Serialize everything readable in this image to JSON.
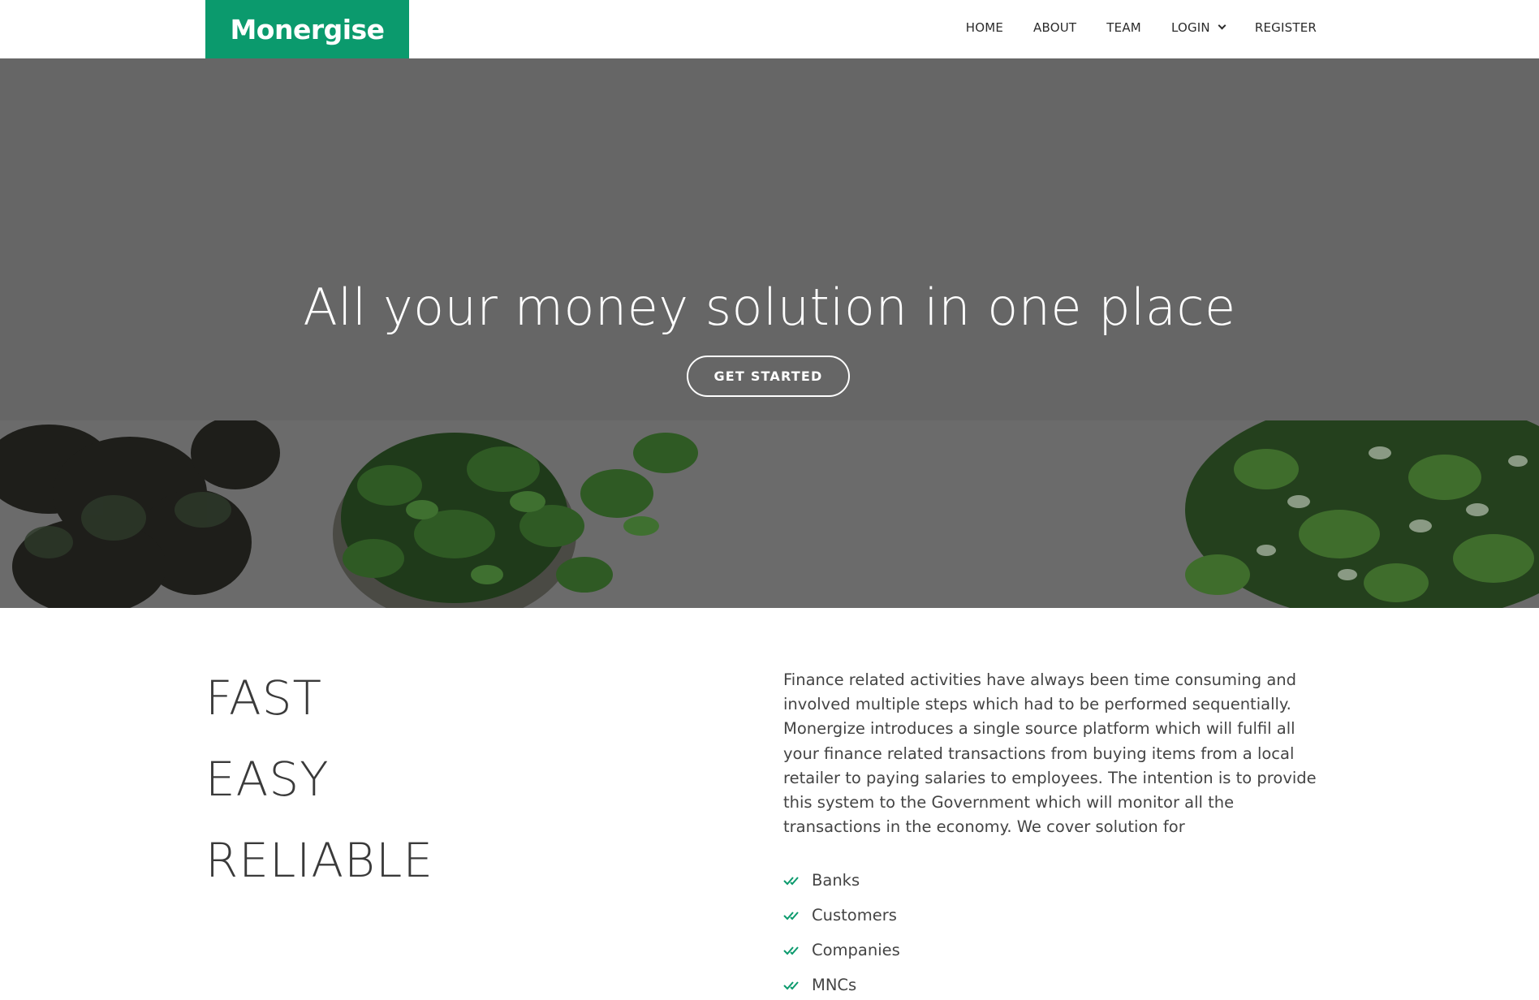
{
  "brand": {
    "name": "Monergise",
    "color": "#0b9a6d"
  },
  "nav": {
    "items": [
      "HOME",
      "ABOUT",
      "TEAM",
      "LOGIN",
      "REGISTER"
    ]
  },
  "hero": {
    "title": "All your money solution in one place",
    "button": "GET STARTED",
    "overlay_color": "#666666"
  },
  "taglines": [
    "FAST",
    "EASY",
    "RELIABLE"
  ],
  "description": "Finance related activities have always been time consuming and involved multiple steps which had to be performed sequentially. Monergize introduces a single source platform which will fulfil all your finance related transactions from buying items from a local retailer to paying salaries to employees. The intention is to provide this system to the Government which will monitor all the transactions in the economy. We cover solution for",
  "solutions": [
    "Banks",
    "Customers",
    "Companies",
    "MNCs"
  ]
}
